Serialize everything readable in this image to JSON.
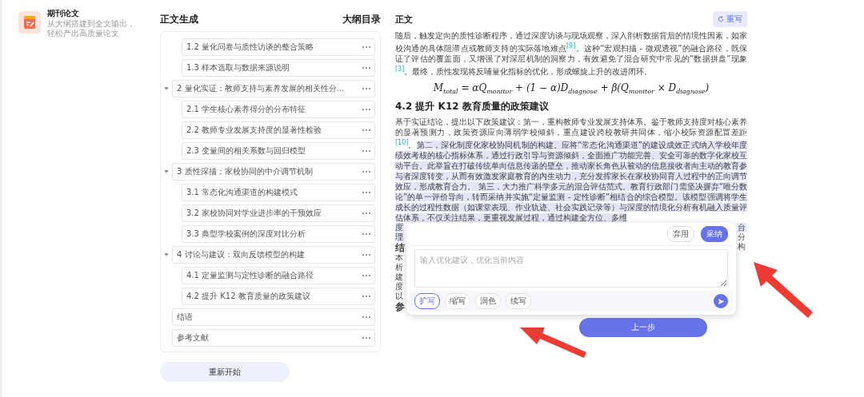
{
  "sidebar": {
    "app_card": {
      "title": "期刊论文",
      "description": [
        "从大纲搭建到全文输出，",
        "轻松产出高质量论文"
      ]
    }
  },
  "outline_panel": {
    "title": "正文生成",
    "subtitle": "大纲目录",
    "items": [
      {
        "children": [
          {
            "label": "1.2 量化问卷与质性访谈的整合策略"
          },
          {
            "label": "1.3 样本选取与数据来源说明"
          }
        ]
      },
      {
        "label": "2 量化实证：教师支持与素养发展的相关性分...",
        "expanded": true,
        "children": [
          {
            "label": "2.1 学生核心素养得分的分布特征"
          },
          {
            "label": "2.2 教师专业发展支持度的显著性检验"
          },
          {
            "label": "2.3 变量间的相关系数与回归模型"
          }
        ]
      },
      {
        "label": "3 质性深描：家校协同的中介调节机制",
        "expanded": true,
        "children": [
          {
            "label": "3.1 常态化沟通渠道的构建模式"
          },
          {
            "label": "3.2 家校协同对学业进步率的干预效应"
          },
          {
            "label": "3.3 典型学校案例的深度对比分析"
          }
        ]
      },
      {
        "label": "4 讨论与建议：双向反馈模型的构建",
        "expanded": true,
        "children": [
          {
            "label": "4.1 定量监测与定性诊断的融合路径"
          },
          {
            "label": "4.2 提升 K12 教育质量的政策建议"
          }
        ]
      },
      {
        "label": "结语"
      },
      {
        "label": "参考文献"
      }
    ],
    "restart_button": "重新开始"
  },
  "content_panel": {
    "title": "正文",
    "rewrite_button": "重写",
    "paragraph_1": "随后，触发定向的质性诊断程序，通过深度访谈与现场观察，深入剖析数据背后的情境性因素，如家校沟通的具体阻滞点或教师支持的实际落地难点$^{[9]}$。这种“宏观扫描 - 微观透视”的融合路径，既保证了评估的覆盖面，又增强了对深层机制的洞察力，有效避免了混合研究中常见的“数据拼盘”现象$^{[3]}$。最终，质性发现将反哺量化指标的优化，形成螺旋上升的改进闭环。",
    "formula": "M$_{total}$ = αQ$_{monitor}$ + (1 − α)D$_{diagnose}$ + β(Q$_{monitor}$ × D$_{diagnose}$)",
    "heading": "4.2 提升 K12 教育质量的政策建议",
    "paragraph_2": [
      {
        "text": "基于实证结论，提出以下政策建议：第一，重构教师专业发展支持体系。鉴于教师支持度对核心素养的显著预测力，政策资源应向薄弱学校倾斜，重点建设跨校教研共同体，缩小校际资源配置差距$^{[10]}$。",
        "highlighted": false
      },
      {
        "text": "第二，深化制度化家校协同机制的构建。应将“常态化沟通渠道”的建设成效正式纳入学校年度绩效考核的核心指标体系，通过行政引导与资源倾斜，全面推广功能完善、安全可靠的数字化家校互动平台。此举旨在打破传统单向信息传递的壁垒，推动家长角色从被动的信息接收者向主动的教育参与者深度转变，从而有效激发家庭教育的内生动力，充分发挥家长在家校协同育人过程中的正向调节效应，形成教育合力。 第三，大力推广科学多元的混合评估范式。教育行政部门需坚决摒弃“唯分数论”的单一评价导向，转而采纳并实施“定量监测 - 定性诊断”相结合的综合模型。该模型强调将学生成长的过程性数据（如课堂表现、作业轨迹、社会实践记录等）与深度的情境化分析有机融入质量评估体系，不仅关注结果，更重视发展过程，通过构建全方位、多维",
        "highlighted": true
      }
    ],
    "covered_fragments_left": [
      {
        "text": "度",
        "kind": "body",
        "highlighted": true
      },
      {
        "text": "理",
        "kind": "body",
        "highlighted": true
      },
      {
        "text": "结",
        "kind": "heading",
        "highlighted": false
      },
      {
        "text": "本",
        "kind": "body",
        "highlighted": false
      },
      {
        "text": "析",
        "kind": "body",
        "highlighted": false
      },
      {
        "text": "建",
        "kind": "body",
        "highlighted": false
      },
      {
        "text": "度",
        "kind": "body",
        "highlighted": false
      },
      {
        "text": "以",
        "kind": "body",
        "highlighted": false
      },
      {
        "text": "参",
        "kind": "heading",
        "highlighted": false
      }
    ],
    "covered_fragments_right": [
      {
        "text": "台",
        "kind": "body",
        "highlighted": true
      },
      {
        "text": "分",
        "kind": "body",
        "highlighted": false
      },
      {
        "text": "构",
        "kind": "body",
        "highlighted": false
      }
    ],
    "previous_button": "上一步"
  },
  "refine_popup": {
    "discard_button": "弃用",
    "accept_button": "采纳",
    "input": {
      "placeholder": "输入优化建议，优化当前内容"
    },
    "chips": [
      {
        "label": "扩写",
        "selected": true
      },
      {
        "label": "缩写",
        "selected": false
      },
      {
        "label": "润色",
        "selected": false
      },
      {
        "label": "续写",
        "selected": false
      }
    ]
  }
}
